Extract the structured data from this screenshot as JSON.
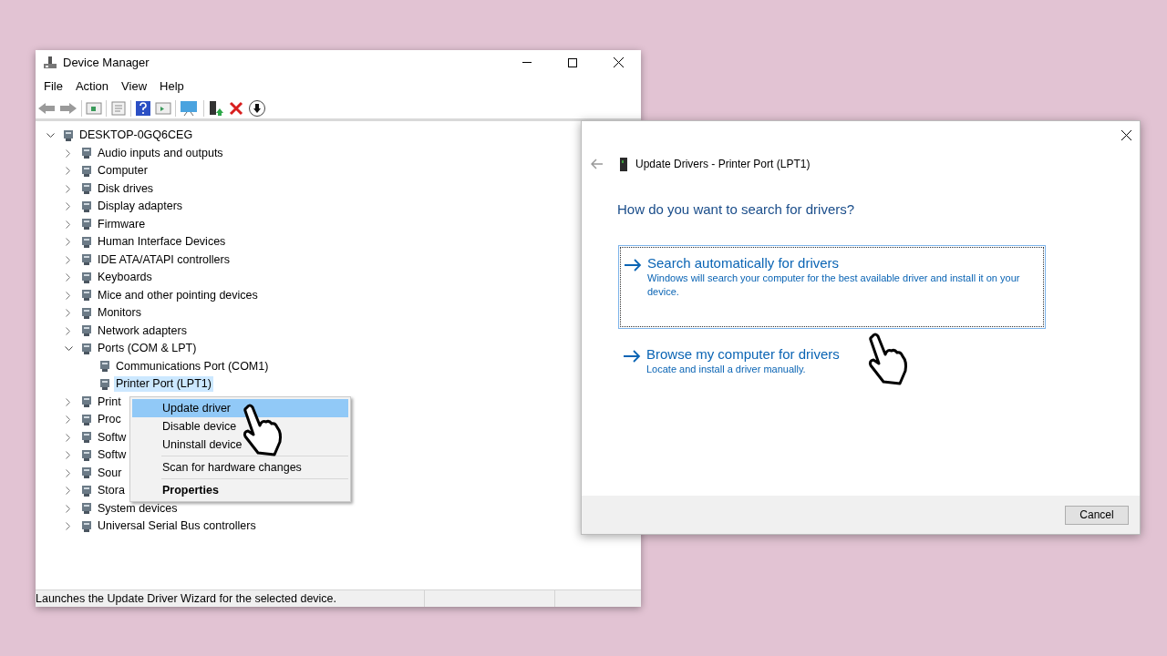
{
  "device_manager": {
    "title": "Device Manager",
    "menu": [
      "File",
      "Action",
      "View",
      "Help"
    ],
    "tree": [
      {
        "label": "DESKTOP-0GQ6CEG",
        "expanded": true,
        "selected": false,
        "children": [
          {
            "label": "Audio inputs and outputs",
            "expanded": false,
            "selected": false
          },
          {
            "label": "Computer",
            "expanded": false,
            "selected": false
          },
          {
            "label": "Disk drives",
            "expanded": false,
            "selected": false
          },
          {
            "label": "Display adapters",
            "expanded": false,
            "selected": false
          },
          {
            "label": "Firmware",
            "expanded": false,
            "selected": false
          },
          {
            "label": "Human Interface Devices",
            "expanded": false,
            "selected": false
          },
          {
            "label": "IDE ATA/ATAPI controllers",
            "expanded": false,
            "selected": false
          },
          {
            "label": "Keyboards",
            "expanded": false,
            "selected": false
          },
          {
            "label": "Mice and other pointing devices",
            "expanded": false,
            "selected": false
          },
          {
            "label": "Monitors",
            "expanded": false,
            "selected": false
          },
          {
            "label": "Network adapters",
            "expanded": false,
            "selected": false
          },
          {
            "label": "Ports (COM & LPT)",
            "expanded": true,
            "selected": false,
            "children": [
              {
                "label": "Communications Port (COM1)",
                "selected": false
              },
              {
                "label": "Printer Port (LPT1)",
                "selected": true
              }
            ]
          },
          {
            "label": "Print",
            "expanded": false,
            "selected": false
          },
          {
            "label": "Proc",
            "expanded": false,
            "selected": false
          },
          {
            "label": "Softw",
            "expanded": false,
            "selected": false
          },
          {
            "label": "Softw",
            "expanded": false,
            "selected": false
          },
          {
            "label": "Sour",
            "expanded": false,
            "selected": false
          },
          {
            "label": "Stora",
            "expanded": false,
            "selected": false
          },
          {
            "label": "System devices",
            "expanded": false,
            "selected": false
          },
          {
            "label": "Universal Serial Bus controllers",
            "expanded": false,
            "selected": false
          }
        ]
      }
    ],
    "context_menu": [
      {
        "kind": "item",
        "label": "Update driver",
        "selected": true,
        "default": false
      },
      {
        "kind": "item",
        "label": "Disable device",
        "selected": false,
        "default": false
      },
      {
        "kind": "item",
        "label": "Uninstall device",
        "selected": false,
        "default": false
      },
      {
        "kind": "separator"
      },
      {
        "kind": "item",
        "label": "Scan for hardware changes",
        "selected": false,
        "default": false
      },
      {
        "kind": "separator"
      },
      {
        "kind": "item",
        "label": "Properties",
        "selected": false,
        "default": true
      }
    ],
    "status_bar": "Launches the Update Driver Wizard for the selected device."
  },
  "update_dialog": {
    "title": "Update Drivers - Printer Port (LPT1)",
    "heading": "How do you want to search for drivers?",
    "options": [
      {
        "title": "Search automatically for drivers",
        "description": "Windows will search your computer for the best available driver and install it on your device.",
        "selected": true
      },
      {
        "title": "Browse my computer for drivers",
        "description": "Locate and install a driver manually.",
        "selected": false
      }
    ],
    "cancel": "Cancel"
  }
}
